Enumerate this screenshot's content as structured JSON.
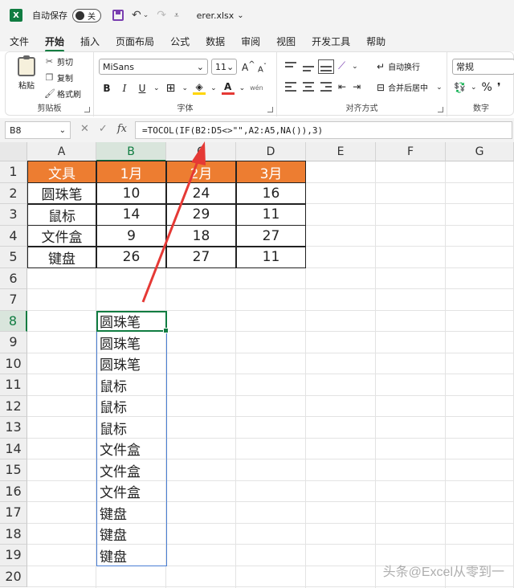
{
  "titlebar": {
    "app_icon": "X",
    "autosave_label": "自动保存",
    "toggle_state": "关",
    "filename": "erer.xlsx"
  },
  "tabs": [
    "文件",
    "开始",
    "插入",
    "页面布局",
    "公式",
    "数据",
    "审阅",
    "视图",
    "开发工具",
    "帮助"
  ],
  "active_tab": "开始",
  "ribbon": {
    "clipboard": {
      "paste": "粘贴",
      "cut": "剪切",
      "copy": "复制",
      "format_painter": "格式刷",
      "label": "剪贴板"
    },
    "font": {
      "name": "MiSans",
      "size": "11",
      "label": "字体",
      "bold": "B",
      "italic": "I",
      "underline": "U",
      "grow": "A",
      "shrink": "A",
      "wen": "wén"
    },
    "alignment": {
      "wrap": "自动换行",
      "merge": "合并后居中",
      "label": "对齐方式"
    },
    "number": {
      "format": "常规",
      "percent": "%",
      "label": "数字"
    }
  },
  "formula_bar": {
    "name_box": "B8",
    "fx": "fx",
    "formula": "=TOCOL(IF(B2:D5<>\"\",A2:A5,NA()),3)"
  },
  "columns": [
    "A",
    "B",
    "C",
    "D",
    "E",
    "F",
    "G"
  ],
  "rows": [
    "1",
    "2",
    "3",
    "4",
    "5",
    "6",
    "7",
    "8",
    "9",
    "10",
    "11",
    "12",
    "13",
    "14",
    "15",
    "16",
    "17",
    "18",
    "19",
    "20"
  ],
  "table": {
    "header": [
      "文具",
      "1月",
      "2月",
      "3月"
    ],
    "body": [
      [
        "圆珠笔",
        "10",
        "24",
        "16"
      ],
      [
        "鼠标",
        "14",
        "29",
        "11"
      ],
      [
        "文件盒",
        "9",
        "18",
        "27"
      ],
      [
        "键盘",
        "26",
        "27",
        "11"
      ]
    ]
  },
  "results": [
    "圆珠笔",
    "圆珠笔",
    "圆珠笔",
    "鼠标",
    "鼠标",
    "鼠标",
    "文件盒",
    "文件盒",
    "文件盒",
    "键盘",
    "键盘",
    "键盘"
  ],
  "watermark": "头条@Excel从零到一",
  "colors": {
    "excel_green": "#107c41",
    "header_orange": "#ed7d31",
    "arrow_red": "#e53935",
    "spill_blue": "#4a7fd4"
  }
}
